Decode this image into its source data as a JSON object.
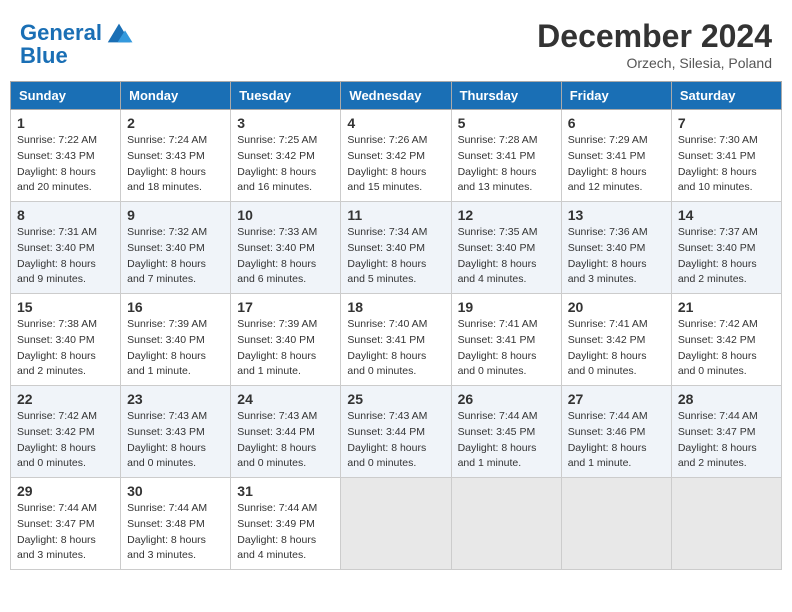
{
  "header": {
    "logo_line1": "General",
    "logo_line2": "Blue",
    "month_title": "December 2024",
    "subtitle": "Orzech, Silesia, Poland"
  },
  "days_of_week": [
    "Sunday",
    "Monday",
    "Tuesday",
    "Wednesday",
    "Thursday",
    "Friday",
    "Saturday"
  ],
  "weeks": [
    [
      {
        "day": "1",
        "sunrise": "7:22 AM",
        "sunset": "3:43 PM",
        "daylight": "8 hours and 20 minutes."
      },
      {
        "day": "2",
        "sunrise": "7:24 AM",
        "sunset": "3:43 PM",
        "daylight": "8 hours and 18 minutes."
      },
      {
        "day": "3",
        "sunrise": "7:25 AM",
        "sunset": "3:42 PM",
        "daylight": "8 hours and 16 minutes."
      },
      {
        "day": "4",
        "sunrise": "7:26 AM",
        "sunset": "3:42 PM",
        "daylight": "8 hours and 15 minutes."
      },
      {
        "day": "5",
        "sunrise": "7:28 AM",
        "sunset": "3:41 PM",
        "daylight": "8 hours and 13 minutes."
      },
      {
        "day": "6",
        "sunrise": "7:29 AM",
        "sunset": "3:41 PM",
        "daylight": "8 hours and 12 minutes."
      },
      {
        "day": "7",
        "sunrise": "7:30 AM",
        "sunset": "3:41 PM",
        "daylight": "8 hours and 10 minutes."
      }
    ],
    [
      {
        "day": "8",
        "sunrise": "7:31 AM",
        "sunset": "3:40 PM",
        "daylight": "8 hours and 9 minutes."
      },
      {
        "day": "9",
        "sunrise": "7:32 AM",
        "sunset": "3:40 PM",
        "daylight": "8 hours and 7 minutes."
      },
      {
        "day": "10",
        "sunrise": "7:33 AM",
        "sunset": "3:40 PM",
        "daylight": "8 hours and 6 minutes."
      },
      {
        "day": "11",
        "sunrise": "7:34 AM",
        "sunset": "3:40 PM",
        "daylight": "8 hours and 5 minutes."
      },
      {
        "day": "12",
        "sunrise": "7:35 AM",
        "sunset": "3:40 PM",
        "daylight": "8 hours and 4 minutes."
      },
      {
        "day": "13",
        "sunrise": "7:36 AM",
        "sunset": "3:40 PM",
        "daylight": "8 hours and 3 minutes."
      },
      {
        "day": "14",
        "sunrise": "7:37 AM",
        "sunset": "3:40 PM",
        "daylight": "8 hours and 2 minutes."
      }
    ],
    [
      {
        "day": "15",
        "sunrise": "7:38 AM",
        "sunset": "3:40 PM",
        "daylight": "8 hours and 2 minutes."
      },
      {
        "day": "16",
        "sunrise": "7:39 AM",
        "sunset": "3:40 PM",
        "daylight": "8 hours and 1 minute."
      },
      {
        "day": "17",
        "sunrise": "7:39 AM",
        "sunset": "3:40 PM",
        "daylight": "8 hours and 1 minute."
      },
      {
        "day": "18",
        "sunrise": "7:40 AM",
        "sunset": "3:41 PM",
        "daylight": "8 hours and 0 minutes."
      },
      {
        "day": "19",
        "sunrise": "7:41 AM",
        "sunset": "3:41 PM",
        "daylight": "8 hours and 0 minutes."
      },
      {
        "day": "20",
        "sunrise": "7:41 AM",
        "sunset": "3:42 PM",
        "daylight": "8 hours and 0 minutes."
      },
      {
        "day": "21",
        "sunrise": "7:42 AM",
        "sunset": "3:42 PM",
        "daylight": "8 hours and 0 minutes."
      }
    ],
    [
      {
        "day": "22",
        "sunrise": "7:42 AM",
        "sunset": "3:42 PM",
        "daylight": "8 hours and 0 minutes."
      },
      {
        "day": "23",
        "sunrise": "7:43 AM",
        "sunset": "3:43 PM",
        "daylight": "8 hours and 0 minutes."
      },
      {
        "day": "24",
        "sunrise": "7:43 AM",
        "sunset": "3:44 PM",
        "daylight": "8 hours and 0 minutes."
      },
      {
        "day": "25",
        "sunrise": "7:43 AM",
        "sunset": "3:44 PM",
        "daylight": "8 hours and 0 minutes."
      },
      {
        "day": "26",
        "sunrise": "7:44 AM",
        "sunset": "3:45 PM",
        "daylight": "8 hours and 1 minute."
      },
      {
        "day": "27",
        "sunrise": "7:44 AM",
        "sunset": "3:46 PM",
        "daylight": "8 hours and 1 minute."
      },
      {
        "day": "28",
        "sunrise": "7:44 AM",
        "sunset": "3:47 PM",
        "daylight": "8 hours and 2 minutes."
      }
    ],
    [
      {
        "day": "29",
        "sunrise": "7:44 AM",
        "sunset": "3:47 PM",
        "daylight": "8 hours and 3 minutes."
      },
      {
        "day": "30",
        "sunrise": "7:44 AM",
        "sunset": "3:48 PM",
        "daylight": "8 hours and 3 minutes."
      },
      {
        "day": "31",
        "sunrise": "7:44 AM",
        "sunset": "3:49 PM",
        "daylight": "8 hours and 4 minutes."
      },
      null,
      null,
      null,
      null
    ]
  ],
  "labels": {
    "sunrise": "Sunrise:",
    "sunset": "Sunset:",
    "daylight": "Daylight:"
  }
}
